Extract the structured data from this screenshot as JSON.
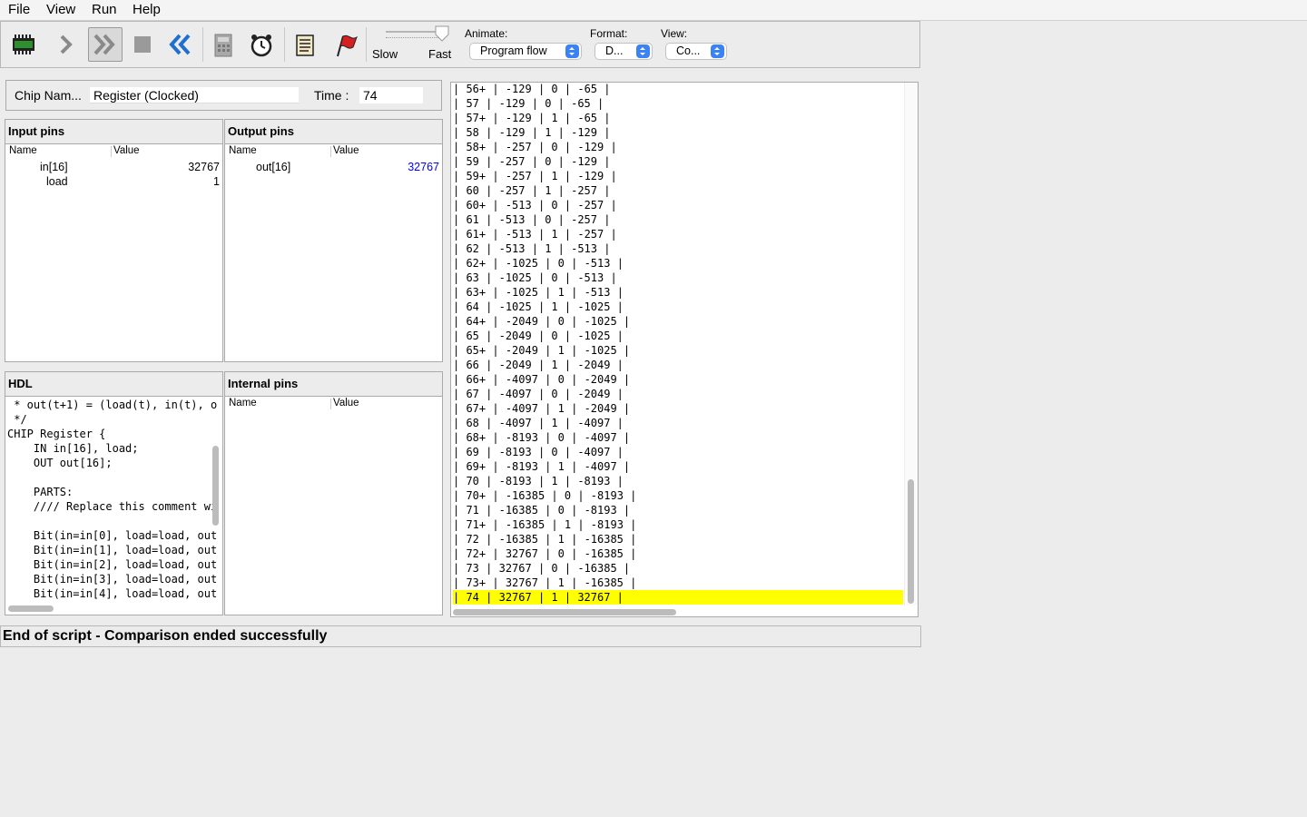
{
  "menu": [
    "File",
    "View",
    "Run",
    "Help"
  ],
  "toolbar": {
    "buttons": [
      "load-chip-icon",
      "single-step-icon",
      "fast-forward-icon",
      "stop-icon",
      "rewind-icon",
      "calculator-icon",
      "clock-icon",
      "script-icon",
      "breakpoint-flag-icon"
    ],
    "speed_slow_label": "Slow",
    "speed_fast_label": "Fast",
    "speed_level": 1.0,
    "animate_label": "Animate:",
    "animate_value": "Program flow",
    "format_label": "Format:",
    "format_value": "D...",
    "view_label": "View:",
    "view_value": "Co..."
  },
  "chip": {
    "name_label": "Chip Nam...",
    "name_value": "Register (Clocked)",
    "time_label": "Time :",
    "time_value": "74"
  },
  "input_pins": {
    "title": "Input pins",
    "col_name": "Name",
    "col_value": "Value",
    "rows": [
      {
        "name": "in[16]",
        "value": "32767"
      },
      {
        "name": "load",
        "value": "1"
      }
    ]
  },
  "output_pins": {
    "title": "Output pins",
    "col_name": "Name",
    "col_value": "Value",
    "rows": [
      {
        "name": "out[16]",
        "value": "32767"
      }
    ]
  },
  "hdl": {
    "title": "HDL",
    "lines": [
      " * out(t+1) = (load(t), in(t), o",
      " */",
      "CHIP Register {",
      "    IN in[16], load;",
      "    OUT out[16];",
      "",
      "    PARTS:",
      "    //// Replace this comment wi",
      "",
      "    Bit(in=in[0], load=load, out",
      "    Bit(in=in[1], load=load, out",
      "    Bit(in=in[2], load=load, out",
      "    Bit(in=in[3], load=load, out",
      "    Bit(in=in[4], load=load, out"
    ]
  },
  "internal_pins": {
    "title": "Internal pins",
    "col_name": "Name",
    "col_value": "Value"
  },
  "compare": {
    "rows": [
      [
        "56+",
        "-129",
        "0",
        "-65"
      ],
      [
        "57",
        "-129",
        "0",
        "-65"
      ],
      [
        "57+",
        "-129",
        "1",
        "-65"
      ],
      [
        "58",
        "-129",
        "1",
        "-129"
      ],
      [
        "58+",
        "-257",
        "0",
        "-129"
      ],
      [
        "59",
        "-257",
        "0",
        "-129"
      ],
      [
        "59+",
        "-257",
        "1",
        "-129"
      ],
      [
        "60",
        "-257",
        "1",
        "-257"
      ],
      [
        "60+",
        "-513",
        "0",
        "-257"
      ],
      [
        "61",
        "-513",
        "0",
        "-257"
      ],
      [
        "61+",
        "-513",
        "1",
        "-257"
      ],
      [
        "62",
        "-513",
        "1",
        "-513"
      ],
      [
        "62+",
        "-1025",
        "0",
        "-513"
      ],
      [
        "63",
        "-1025",
        "0",
        "-513"
      ],
      [
        "63+",
        "-1025",
        "1",
        "-513"
      ],
      [
        "64",
        "-1025",
        "1",
        "-1025"
      ],
      [
        "64+",
        "-2049",
        "0",
        "-1025"
      ],
      [
        "65",
        "-2049",
        "0",
        "-1025"
      ],
      [
        "65+",
        "-2049",
        "1",
        "-1025"
      ],
      [
        "66",
        "-2049",
        "1",
        "-2049"
      ],
      [
        "66+",
        "-4097",
        "0",
        "-2049"
      ],
      [
        "67",
        "-4097",
        "0",
        "-2049"
      ],
      [
        "67+",
        "-4097",
        "1",
        "-2049"
      ],
      [
        "68",
        "-4097",
        "1",
        "-4097"
      ],
      [
        "68+",
        "-8193",
        "0",
        "-4097"
      ],
      [
        "69",
        "-8193",
        "0",
        "-4097"
      ],
      [
        "69+",
        "-8193",
        "1",
        "-4097"
      ],
      [
        "70",
        "-8193",
        "1",
        "-8193"
      ],
      [
        "70+",
        "-16385",
        "0",
        "-8193"
      ],
      [
        "71",
        "-16385",
        "0",
        "-8193"
      ],
      [
        "71+",
        "-16385",
        "1",
        "-8193"
      ],
      [
        "72",
        "-16385",
        "1",
        "-16385"
      ],
      [
        "72+",
        "32767",
        "0",
        "-16385"
      ],
      [
        "73",
        "32767",
        "0",
        "-16385"
      ],
      [
        "73+",
        "32767",
        "1",
        "-16385"
      ],
      [
        "74",
        "32767",
        "1",
        "32767"
      ]
    ],
    "highlight_color": "#ffff00"
  },
  "status": "End of script - Comparison ended successfully",
  "colors": {
    "output_value": "#0000ff",
    "highlight": "#ffff00",
    "select_arrow": "#3b82f6"
  }
}
